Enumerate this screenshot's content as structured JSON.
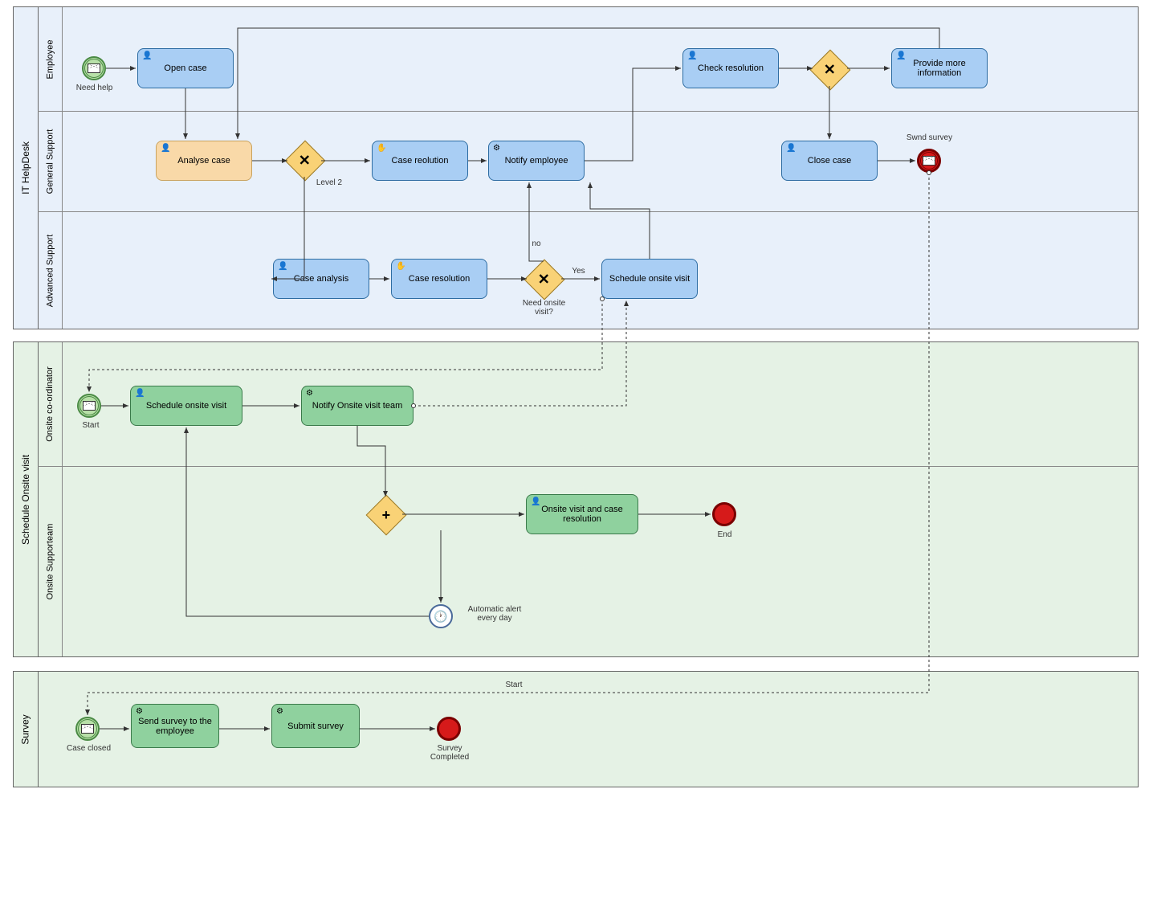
{
  "pools": {
    "it_helpdesk": {
      "name": "IT HelpDesk"
    },
    "schedule_onsite": {
      "name": "Schedule Onsite visit"
    },
    "survey": {
      "name": "Survey"
    }
  },
  "lanes": {
    "employee": {
      "name": "Employee"
    },
    "general_support": {
      "name": "General Support"
    },
    "advanced_support": {
      "name": "Advanced Support"
    },
    "onsite_coordinator": {
      "name": "Onsite co-ordinator"
    },
    "onsite_supportteam": {
      "name": "Onsite Supporteam"
    }
  },
  "tasks": {
    "open_case": "Open case",
    "analyse_case": "Analyse case",
    "case_reolution": "Case reolution",
    "notify_employee": "Notify employee",
    "check_resolution": "Check resolution",
    "close_case": "Close case",
    "provide_more_info": "Provide more information",
    "case_analysis": "Case analysis",
    "case_resolution2": "Case resolution",
    "schedule_onsite_visit": "Schedule onsite visit",
    "schedule_onsite_visit2": "Schedule onsite visit",
    "notify_onsite_team": "Notify Onsite visit team",
    "onsite_visit_resolution": "Onsite visit and case resolution",
    "send_survey": "Send survey to the employee",
    "submit_survey": "Submit survey"
  },
  "labels": {
    "need_help": "Need help",
    "level2": "Level 2",
    "no": "no",
    "yes": "Yes",
    "need_onsite": "Need onsite visit?",
    "swnd_survey": "Swnd survey",
    "start": "Start",
    "start2": "Start",
    "end": "End",
    "automatic_alert": "Automatic alert every day",
    "case_closed": "Case closed",
    "survey_completed": "Survey Completed"
  }
}
